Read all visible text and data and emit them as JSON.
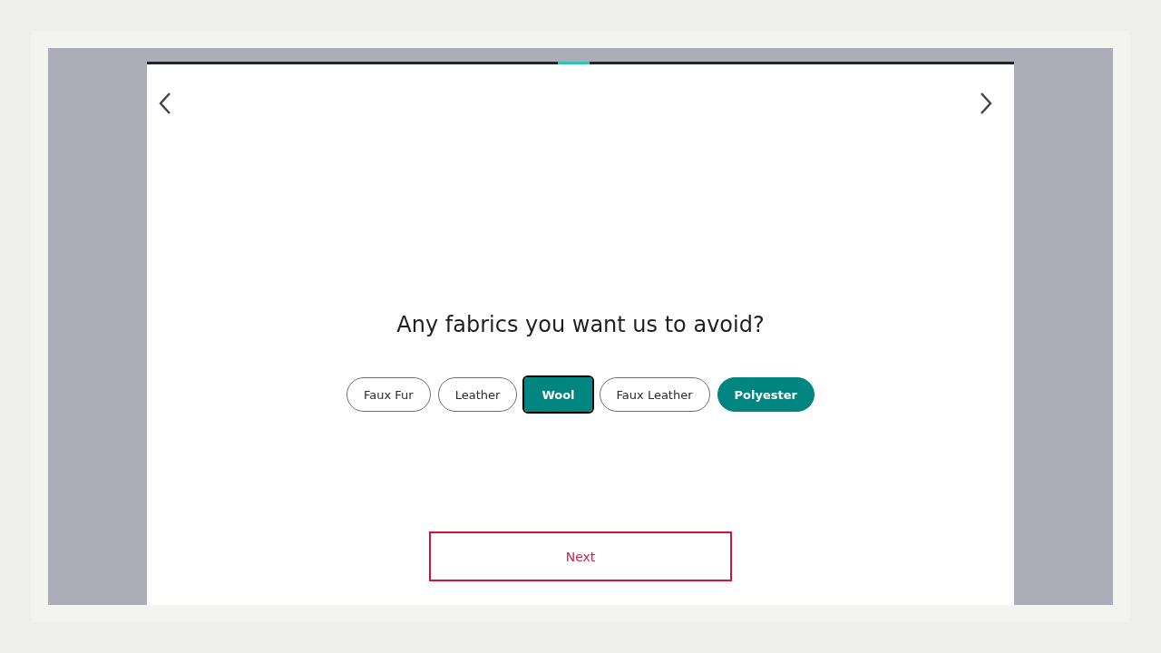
{
  "progress": {
    "level": 0.51
  },
  "question": "Any fabrics you want us to avoid?",
  "options": [
    {
      "label": "Faux Fur",
      "selected": false,
      "focused": false
    },
    {
      "label": "Leather",
      "selected": false,
      "focused": false
    },
    {
      "label": "Wool",
      "selected": true,
      "focused": true
    },
    {
      "label": "Faux Leather",
      "selected": false,
      "focused": false
    },
    {
      "label": "Polyester",
      "selected": true,
      "focused": false
    }
  ],
  "next_button": "Next"
}
